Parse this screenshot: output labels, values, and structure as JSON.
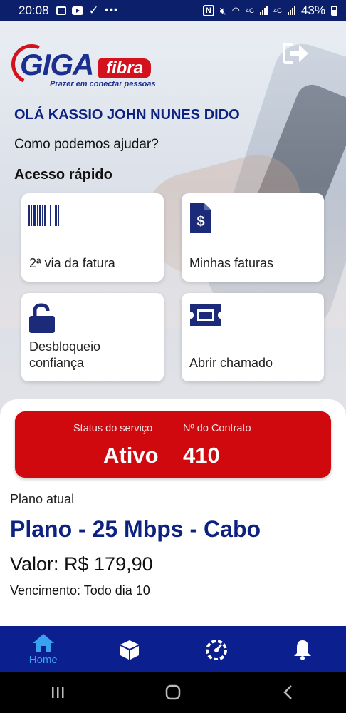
{
  "status_bar": {
    "time": "20:08",
    "network": "4G",
    "battery": "43%"
  },
  "logo": {
    "brand": "GIGA fibra",
    "tagline": "Prazer em conectar pessoas"
  },
  "greeting": "OLÁ KASSIO JOHN NUNES DIDO",
  "subtitle": "Como podemos ajudar?",
  "quick_access": {
    "title": "Acesso rápido",
    "items": [
      {
        "label": "2ª via da fatura",
        "icon": "barcode-icon"
      },
      {
        "label": "Minhas faturas",
        "icon": "invoice-dollar-icon"
      },
      {
        "label": "Desbloqueio confiança",
        "icon": "unlock-icon"
      },
      {
        "label": "Abrir chamado",
        "icon": "ticket-icon"
      }
    ]
  },
  "service": {
    "status_label": "Status do serviço",
    "status_value": "Ativo",
    "contract_label": "Nº do Contrato",
    "contract_value": "410"
  },
  "plan": {
    "label": "Plano atual",
    "name": "Plano - 25 Mbps - Cabo",
    "price": "Valor: R$ 179,90",
    "due": "Vencimento: Todo dia 10"
  },
  "bottom_nav": [
    {
      "label": "Home",
      "icon": "home-icon",
      "active": true
    },
    {
      "label": "",
      "icon": "box-icon",
      "active": false
    },
    {
      "label": "",
      "icon": "speedometer-icon",
      "active": false
    },
    {
      "label": "",
      "icon": "bell-icon",
      "active": false
    }
  ],
  "colors": {
    "brand_blue": "#0d2180",
    "nav_blue": "#0b1f8f",
    "brand_red": "#d0090f",
    "active_nav": "#3aa0f0"
  }
}
